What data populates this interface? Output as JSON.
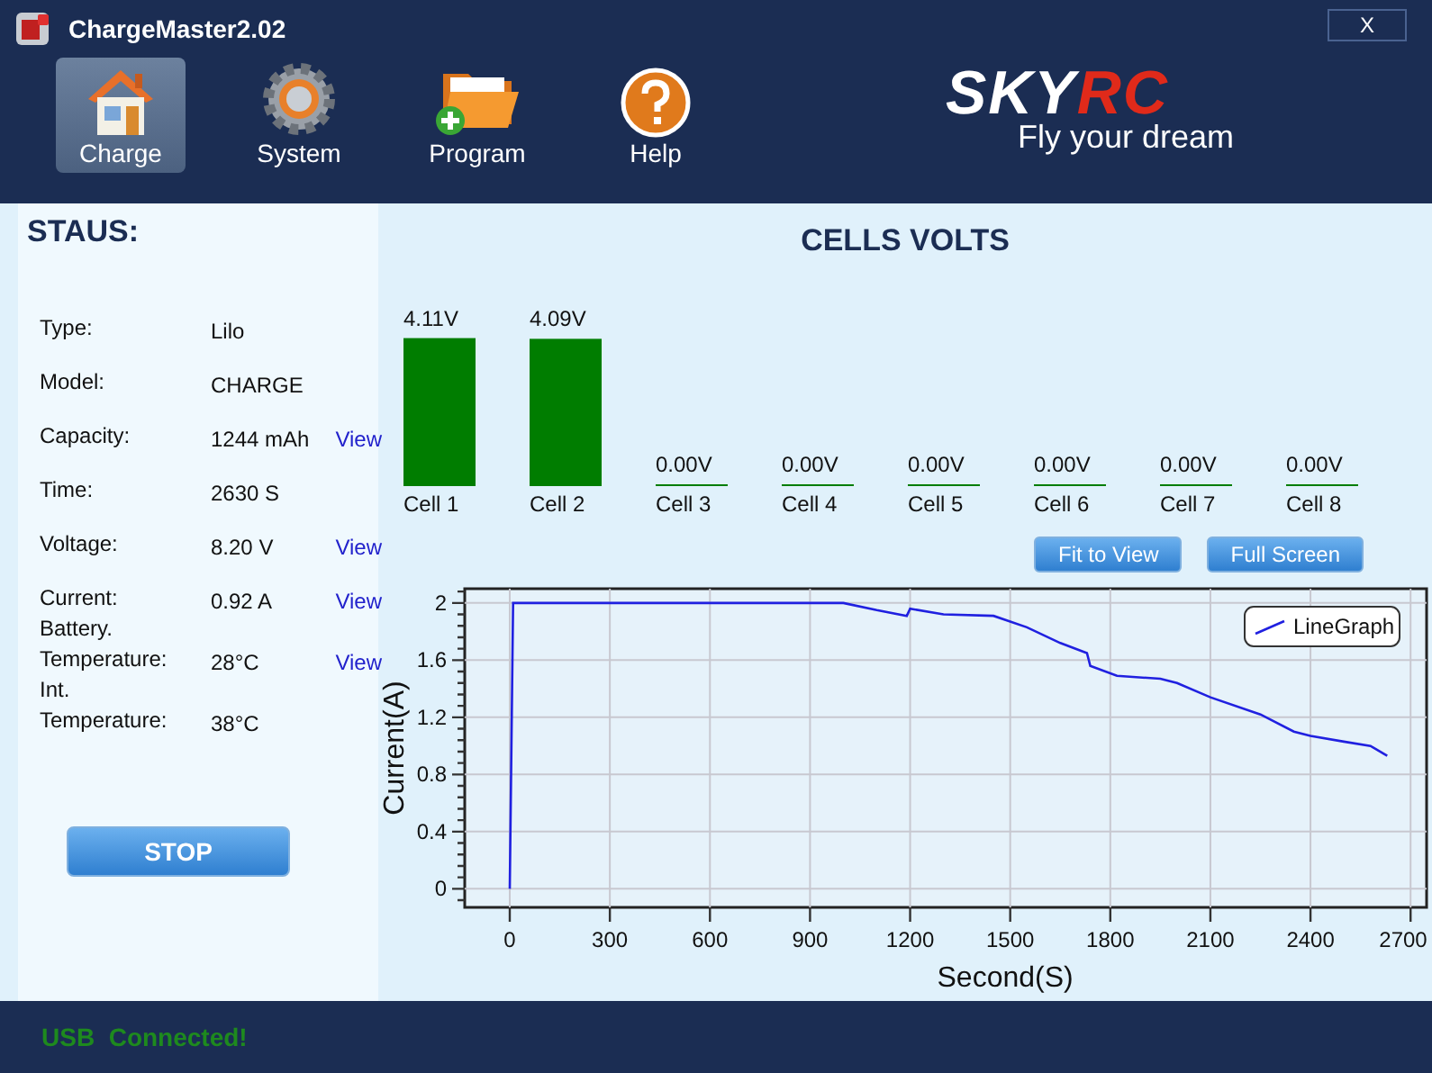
{
  "window": {
    "title": "ChargeMaster2.02",
    "close": "X"
  },
  "nav": [
    {
      "label": "Charge",
      "kind": "house",
      "selected": true
    },
    {
      "label": "System",
      "kind": "gear",
      "selected": false
    },
    {
      "label": "Program",
      "kind": "folder",
      "selected": false
    },
    {
      "label": "Help",
      "kind": "help",
      "selected": false
    }
  ],
  "logo": {
    "brand_left": "SKY",
    "brand_right": "RC",
    "tagline": "Fly your dream"
  },
  "status": {
    "title": "STAUS:",
    "rows": [
      {
        "label": "Type:",
        "value": "Lilo"
      },
      {
        "label": "Model:",
        "value": "CHARGE"
      },
      {
        "label": "Capacity:",
        "value": "1244 mAh",
        "link": "View"
      },
      {
        "label": "Time:",
        "value": "2630 S"
      },
      {
        "label": "Voltage:",
        "value": "8.20 V",
        "link": "View"
      },
      {
        "label": "Current:",
        "value": "0.92 A",
        "link": "View"
      },
      {
        "label": "Battery.\nTemperature:",
        "value": "28°C",
        "link": "View"
      },
      {
        "label": "Int.\nTemperature:",
        "value": "38°C"
      }
    ],
    "stop_button": "STOP"
  },
  "cells": {
    "title": "CELLS VOLTS",
    "chart_data": {
      "type": "bar",
      "categories": [
        "Cell 1",
        "Cell 2",
        "Cell 3",
        "Cell 4",
        "Cell 5",
        "Cell 6",
        "Cell 7",
        "Cell 8"
      ],
      "values": [
        4.11,
        4.09,
        0,
        0,
        0,
        0,
        0,
        0
      ],
      "value_labels": [
        "4.11V",
        "4.09V",
        "0.00V",
        "0.00V",
        "0.00V",
        "0.00V",
        "0.00V",
        "0.00V"
      ],
      "color": "#007d00"
    }
  },
  "graph_buttons": [
    "Fit to View",
    "Full Screen"
  ],
  "graph": {
    "chart_data": {
      "type": "line",
      "xlabel": "Second(S)",
      "ylabel": "Current(A)",
      "x": [
        0,
        10,
        1000,
        1100,
        1190,
        1200,
        1300,
        1450,
        1550,
        1650,
        1730,
        1740,
        1820,
        1950,
        2000,
        2100,
        2250,
        2350,
        2400,
        2500,
        2580,
        2630
      ],
      "series": [
        {
          "name": "LineGraph",
          "color": "#2020e0",
          "values": [
            0,
            2,
            2,
            1.95,
            1.91,
            1.96,
            1.92,
            1.91,
            1.83,
            1.72,
            1.65,
            1.56,
            1.49,
            1.47,
            1.44,
            1.34,
            1.22,
            1.1,
            1.07,
            1.03,
            1.0,
            0.93
          ]
        }
      ],
      "xlim": [
        -135,
        2748
      ],
      "ylim": [
        -0.13,
        2.1
      ],
      "grid": true,
      "xticks": [
        0,
        300,
        600,
        900,
        1200,
        1500,
        1800,
        2100,
        2400,
        2700
      ],
      "yticks": [
        0,
        0.4,
        0.8,
        1.2,
        1.6,
        2
      ]
    }
  },
  "status_bar": "USB  Connected!"
}
